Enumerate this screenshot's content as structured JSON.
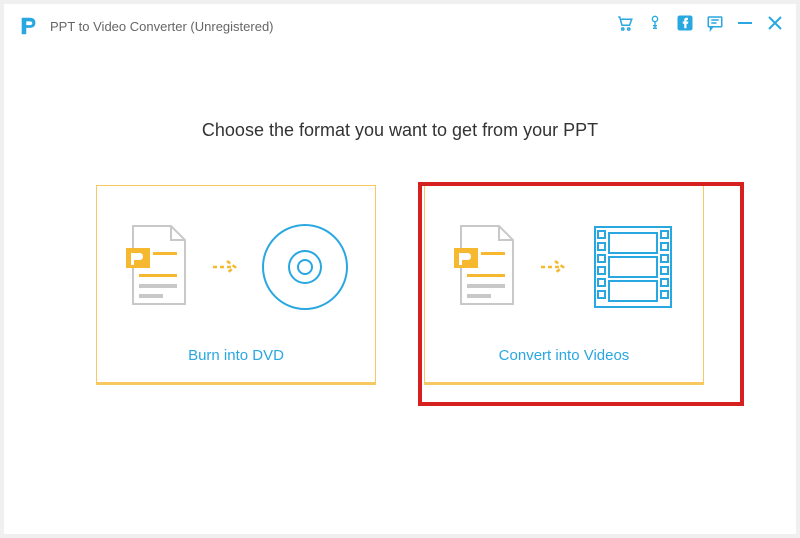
{
  "window": {
    "title": "PPT to Video Converter (Unregistered)"
  },
  "main": {
    "heading": "Choose the format you want to get from your PPT",
    "options": {
      "burn_dvd": {
        "label": "Burn into DVD"
      },
      "convert_video": {
        "label": "Convert into Videos"
      }
    }
  },
  "colors": {
    "accent": "#29a7e1",
    "amber": "#f6c85f",
    "highlight": "#d62020"
  }
}
